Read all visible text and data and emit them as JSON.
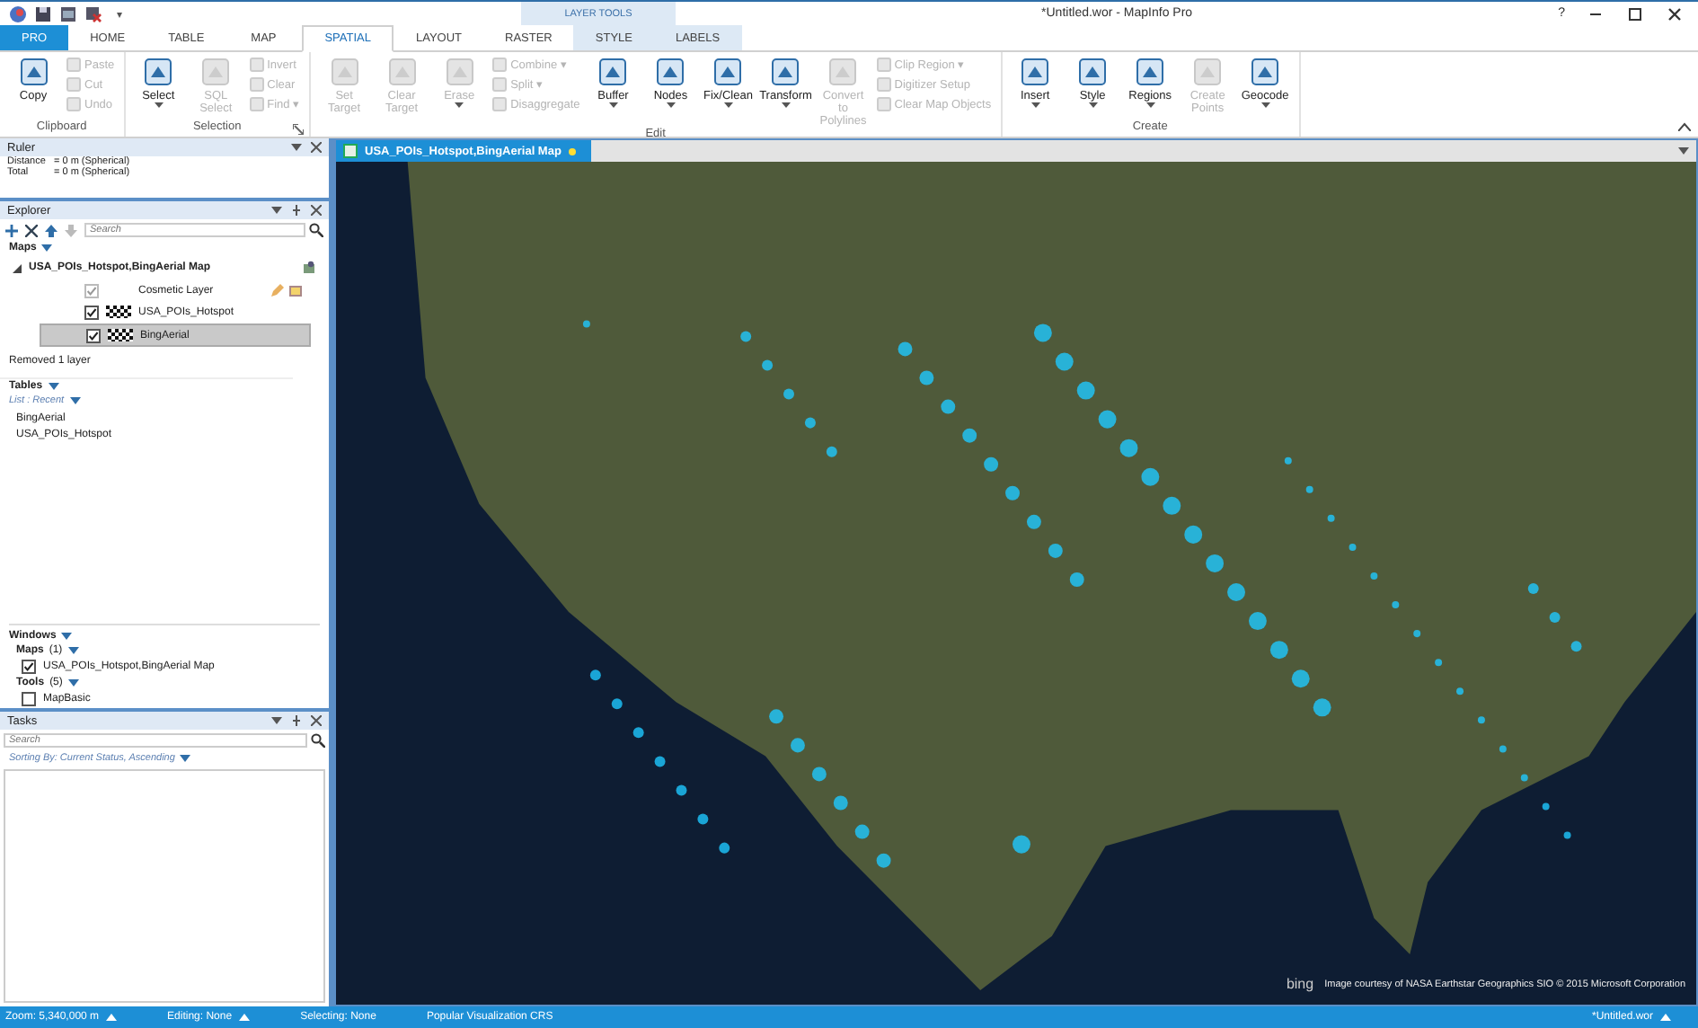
{
  "window": {
    "title": "*Untitled.wor - MapInfo Pro",
    "help": "?",
    "quick_access_more": "▾"
  },
  "contextual_header": "LAYER TOOLS",
  "tabs": [
    {
      "label": "PRO",
      "kind": "file",
      "selected": false
    },
    {
      "label": "HOME",
      "kind": "normal",
      "selected": false
    },
    {
      "label": "TABLE",
      "kind": "normal",
      "selected": false
    },
    {
      "label": "MAP",
      "kind": "normal",
      "selected": false
    },
    {
      "label": "SPATIAL",
      "kind": "normal",
      "selected": true
    },
    {
      "label": "LAYOUT",
      "kind": "normal",
      "selected": false
    },
    {
      "label": "RASTER",
      "kind": "normal",
      "selected": false
    },
    {
      "label": "STYLE",
      "kind": "contextual",
      "selected": false
    },
    {
      "label": "LABELS",
      "kind": "contextual",
      "selected": false
    }
  ],
  "ribbon": {
    "groups": [
      {
        "label": "Clipboard",
        "launcher": false,
        "items": [
          {
            "kind": "large",
            "label": "Copy",
            "disabled": false,
            "dropdown": false
          },
          {
            "kind": "stack",
            "items": [
              {
                "label": "Paste",
                "disabled": true
              },
              {
                "label": "Cut",
                "disabled": true
              },
              {
                "label": "Undo",
                "disabled": true
              }
            ]
          }
        ]
      },
      {
        "label": "Selection",
        "launcher": true,
        "items": [
          {
            "kind": "large",
            "label": "Select",
            "disabled": false,
            "dropdown": true
          },
          {
            "kind": "large",
            "label": "SQL Select",
            "disabled": true,
            "dropdown": false
          },
          {
            "kind": "stack",
            "items": [
              {
                "label": "Invert",
                "disabled": true
              },
              {
                "label": "Clear",
                "disabled": true
              },
              {
                "label": "Find ▾",
                "disabled": true
              }
            ]
          }
        ]
      },
      {
        "label": "Edit",
        "launcher": false,
        "items": [
          {
            "kind": "large",
            "label": "Set Target",
            "disabled": true,
            "dropdown": false
          },
          {
            "kind": "large",
            "label": "Clear Target",
            "disabled": true,
            "dropdown": false
          },
          {
            "kind": "large",
            "label": "Erase",
            "disabled": true,
            "dropdown": true
          },
          {
            "kind": "stack",
            "items": [
              {
                "label": "Combine ▾",
                "disabled": true
              },
              {
                "label": "Split ▾",
                "disabled": true
              },
              {
                "label": "Disaggregate",
                "disabled": true
              }
            ]
          },
          {
            "kind": "large",
            "label": "Buffer",
            "disabled": false,
            "dropdown": true
          },
          {
            "kind": "large",
            "label": "Nodes",
            "disabled": false,
            "dropdown": true
          },
          {
            "kind": "large",
            "label": "Fix/Clean",
            "disabled": false,
            "dropdown": true
          },
          {
            "kind": "large",
            "label": "Transform",
            "disabled": false,
            "dropdown": true
          },
          {
            "kind": "large",
            "label": "Convert to Polylines",
            "disabled": true,
            "dropdown": false
          },
          {
            "kind": "stack",
            "items": [
              {
                "label": "Clip Region ▾",
                "disabled": true
              },
              {
                "label": "Digitizer Setup",
                "disabled": true
              },
              {
                "label": "Clear Map Objects",
                "disabled": true
              }
            ]
          }
        ]
      },
      {
        "label": "Create",
        "launcher": false,
        "items": [
          {
            "kind": "large",
            "label": "Insert",
            "disabled": false,
            "dropdown": true
          },
          {
            "kind": "large",
            "label": "Style",
            "disabled": false,
            "dropdown": true
          },
          {
            "kind": "large",
            "label": "Regions",
            "disabled": false,
            "dropdown": true
          },
          {
            "kind": "large",
            "label": "Create Points",
            "disabled": true,
            "dropdown": false
          },
          {
            "kind": "large",
            "label": "Geocode",
            "disabled": false,
            "dropdown": true
          }
        ]
      }
    ]
  },
  "ruler": {
    "title": "Ruler",
    "rows": [
      {
        "label": "Distance",
        "value": "= 0 m (Spherical)"
      },
      {
        "label": "Total",
        "value": "= 0 m (Spherical)"
      }
    ]
  },
  "explorer": {
    "title": "Explorer",
    "search_placeholder": "Search",
    "maps_heading": "Maps",
    "maps": [
      {
        "label": "USA_POIs_Hotspot,BingAerial Map",
        "expanded": true,
        "layers": [
          {
            "label": "Cosmetic Layer",
            "kind": "cosmetic",
            "checked": true,
            "selected": false
          },
          {
            "label": "USA_POIs_Hotspot",
            "kind": "table",
            "checked": true,
            "selected": false
          },
          {
            "label": "BingAerial",
            "kind": "table",
            "checked": true,
            "selected": true
          }
        ]
      }
    ],
    "message": "Removed 1 layer",
    "tables_heading": "Tables",
    "list_filter": "List : Recent",
    "tables": [
      "BingAerial",
      "USA_POIs_Hotspot"
    ],
    "windows_heading": "Windows",
    "window_groups": [
      {
        "label": "Maps",
        "count": "(1)",
        "items": [
          {
            "label": "USA_POIs_Hotspot,BingAerial Map",
            "checked": true
          }
        ]
      },
      {
        "label": "Tools",
        "count": "(5)",
        "items": [
          {
            "label": "MapBasic",
            "checked": false
          }
        ]
      }
    ]
  },
  "tasks": {
    "title": "Tasks",
    "search_placeholder": "Search",
    "sorting": "Sorting By: Current Status, Ascending"
  },
  "document_tab": {
    "title": "USA_POIs_Hotspot,BingAerial Map"
  },
  "map": {
    "logo": "bing",
    "attribution": "Image courtesy of NASA Earthstar Geographics  SIO © 2015 Microsoft Corporation"
  },
  "status_bar": {
    "left": [
      {
        "text": "Zoom: 5,340,000 m",
        "menu": true
      },
      {
        "text": "Editing: None",
        "menu": true
      },
      {
        "text": "Selecting: None",
        "menu": false
      },
      {
        "text": "Popular Visualization CRS",
        "menu": false
      }
    ],
    "right": {
      "text": "*Untitled.wor",
      "menu": true
    }
  }
}
